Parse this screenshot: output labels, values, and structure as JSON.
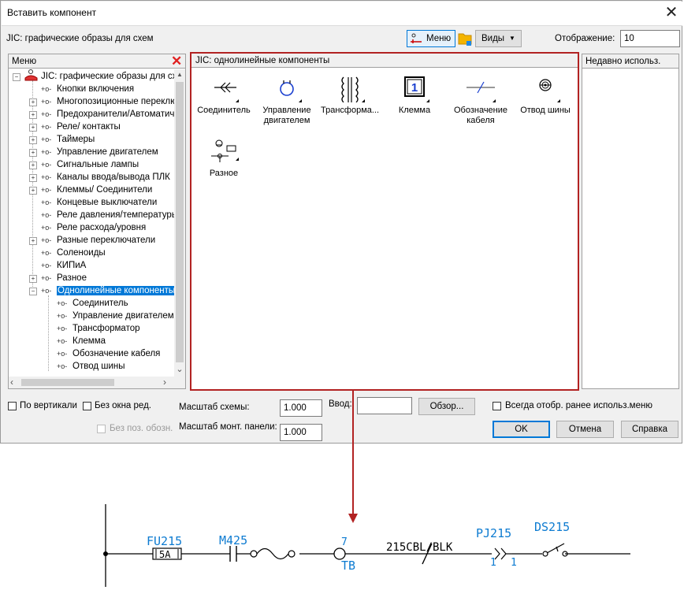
{
  "dialog": {
    "title": "Вставить компонент",
    "library_label": "JIC: графические образы для схем",
    "toolbar": {
      "menu_label": "Меню",
      "views_label": "Виды",
      "display_label": "Отображение:",
      "display_value": "10"
    }
  },
  "menu_panel": {
    "header": "Меню",
    "root": "JIC: графические образы для схем",
    "items": [
      "Кнопки включения",
      "Многопозиционные переключатели",
      "Предохранители/Автоматические выключатели",
      "Реле/ контакты",
      "Таймеры",
      "Управление двигателем",
      "Сигнальные лампы",
      "Каналы ввода/вывода ПЛК",
      "Клеммы/ Соединители",
      "Концевые выключатели",
      "Реле давления/температуры",
      "Реле расхода/уровня",
      "Разные переключатели",
      "Соленоиды",
      "КИПиА",
      "Разное",
      "Однолинейные компоненты"
    ],
    "subitems": [
      "Соединитель",
      "Управление двигателем",
      "Трансформатор",
      "Клемма",
      "Обозначение кабеля",
      "Отвод шины"
    ]
  },
  "component_panel": {
    "header": "JIC: однолинейные компоненты",
    "items": [
      {
        "label": "Соединитель",
        "icon": "connector-icon"
      },
      {
        "label": "Управление двигателем",
        "line1": "Управление",
        "line2": "двигателем",
        "icon": "motor-control-icon"
      },
      {
        "label": "Трансформа...",
        "icon": "transformer-icon"
      },
      {
        "label": "Клемма",
        "icon": "terminal-icon"
      },
      {
        "label": "Обозначение кабеля",
        "line1": "Обозначение",
        "line2": "кабеля",
        "icon": "cable-marker-icon"
      },
      {
        "label": "Отвод шины",
        "icon": "bus-tap-icon"
      },
      {
        "label": "Разное",
        "icon": "misc-icon"
      }
    ]
  },
  "recent_panel": {
    "header": "Недавно использ."
  },
  "options": {
    "vertical": "По вертикали",
    "no_edit": "Без окна ред.",
    "no_pos": "Без поз. обозн.",
    "schematic_scale_label": "Масштаб схемы:",
    "schematic_scale_value": "1.000",
    "panel_scale_label": "Масштаб монт. панели:",
    "panel_scale_value": "1.000",
    "input_label": "Ввод:",
    "input_value": "",
    "browse_label": "Обзор...",
    "always_show": "Всегда отобр. ранее использ.меню"
  },
  "buttons": {
    "ok": "OK",
    "cancel": "Отмена",
    "help": "Справка"
  },
  "diagram": {
    "fuse_tag": "FU215",
    "fuse_rating": "5A",
    "motor_tag": "M425",
    "terminal_number": "7",
    "terminal_tag": "TB",
    "cable_label": "215CBL/BLK",
    "connector_tag": "PJ215",
    "connector_left": "1",
    "connector_right": "1",
    "disconnect_tag": "DS215",
    "colors": {
      "cad_blue": "#0d7bd1",
      "highlight_red": "#b22222",
      "selection_blue": "#0078d7"
    }
  }
}
